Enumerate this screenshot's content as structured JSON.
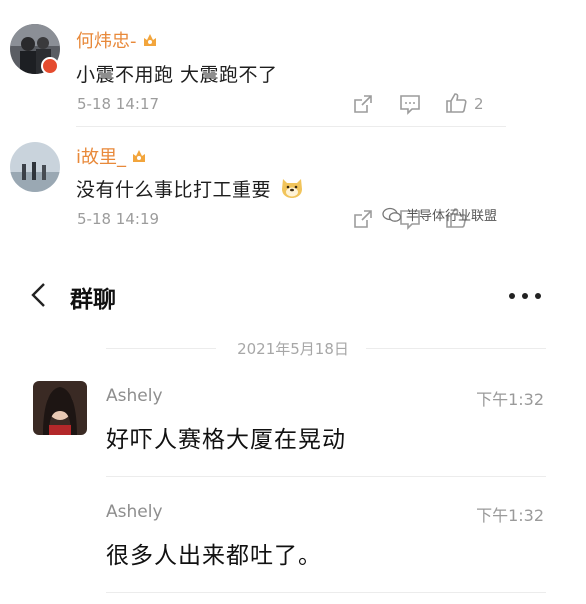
{
  "comments": [
    {
      "user": "何炜忠-",
      "text": "小震不用跑 大震跑不了",
      "time": "5-18 14:17",
      "likes": "2"
    },
    {
      "user": "i故里_",
      "text": "没有什么事比打工重要",
      "time": "5-18 14:19",
      "likes": ""
    }
  ],
  "watermark": "半导体行业联盟",
  "chat": {
    "title": "群聊",
    "date": "2021年5月18日",
    "messages": [
      {
        "sender": "Ashely",
        "time": "下午1:32",
        "text": "好吓人赛格大厦在晃动"
      },
      {
        "sender": "Ashely",
        "time": "下午1:32",
        "text": "很多人出来都吐了。"
      }
    ]
  },
  "icons": {
    "share": "share-icon",
    "comment": "comment-icon",
    "like": "thumbs-up-icon",
    "back": "back-chevron-icon",
    "more": "more-dots-icon"
  },
  "colors": {
    "username": "#e8893a",
    "time_gray": "#9c9c9c",
    "verified_badge": "#e54b2e"
  }
}
